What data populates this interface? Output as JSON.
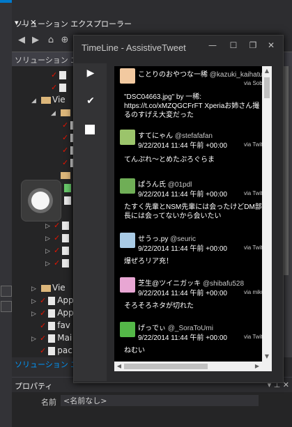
{
  "ide": {
    "solution_explorer_title": "ソリューション エクスプローラー",
    "solution_search_partial": "ソリューション エクス",
    "tree_items": [
      {
        "label": "",
        "checked": true,
        "kind": "image",
        "indent": 4
      },
      {
        "label": "",
        "checked": true,
        "kind": "image",
        "indent": 4
      },
      {
        "label": "Vie",
        "checked": true,
        "kind": "folder",
        "indent": 2,
        "expanded": true
      },
      {
        "label": "",
        "checked": false,
        "kind": "folder",
        "indent": 3
      },
      {
        "label": "",
        "checked": true,
        "kind": "file",
        "indent": 4
      },
      {
        "label": "",
        "checked": true,
        "kind": "file",
        "indent": 4
      },
      {
        "label": "",
        "checked": true,
        "kind": "file",
        "indent": 4
      },
      {
        "label": "",
        "checked": true,
        "kind": "file",
        "indent": 4
      },
      {
        "label": "",
        "checked": false,
        "kind": "folder",
        "indent": 3
      },
      {
        "label": "",
        "checked": false,
        "kind": "code",
        "indent": 4
      },
      {
        "label": "",
        "checked": false,
        "kind": "file",
        "indent": 4
      },
      {
        "label": "",
        "checked": true,
        "kind": "file",
        "indent": 4
      },
      {
        "label": "",
        "checked": true,
        "kind": "file",
        "indent": 4
      },
      {
        "label": "",
        "checked": true,
        "kind": "file",
        "indent": 4
      },
      {
        "label": "",
        "checked": true,
        "kind": "file",
        "indent": 4
      },
      {
        "label": "Vie",
        "checked": false,
        "kind": "folder",
        "indent": 2
      },
      {
        "label": "App",
        "checked": true,
        "kind": "file",
        "indent": 2
      },
      {
        "label": "App",
        "checked": true,
        "kind": "file",
        "indent": 2
      },
      {
        "label": "fav",
        "checked": true,
        "kind": "file",
        "indent": 2
      },
      {
        "label": "Mai",
        "checked": true,
        "kind": "file",
        "indent": 2
      },
      {
        "label": "pac",
        "checked": true,
        "kind": "file",
        "indent": 2
      }
    ],
    "solution_tab": "ソリューション エクスプ",
    "properties_title": "プロパティ",
    "properties_name_label": "名前",
    "properties_name_value": "<名前なし>"
  },
  "timeline": {
    "title": "TimeLine - AssistiveTweet",
    "sidebar_icons": [
      "play-icon",
      "check-icon",
      "stop-icon"
    ],
    "tweets": [
      {
        "name": "ことりのおやつな一稀",
        "screen_name": "@kazuki_kaihatu",
        "date": "",
        "via": "via",
        "source": "Soba",
        "text": "\"DSC04663.jpg\" by 一稀: https://t.co/xMZQGCFrFT Xperiaお姉さん撮るのすげえ大変だった",
        "avatar_color": "#f2c9a0"
      },
      {
        "name": "すてにゃん",
        "screen_name": "@stefafafan",
        "date": "9/22/2014 11:44 午前 +00:00",
        "via": "via",
        "source": "Twitt",
        "text": "てんぷれ～とめたぷろぐらま",
        "avatar_color": "#9bc46b"
      },
      {
        "name": "ぱうん氏",
        "screen_name": "@01pdl",
        "date": "9/22/2014 11:44 午前 +00:00",
        "via": "via",
        "source": "Twitt",
        "text": "たすく先輩とNSM先輩には会ったけどDM部長には会ってないから会いたい",
        "avatar_color": "#6fae56"
      },
      {
        "name": "せうっ.py",
        "screen_name": "@seuric",
        "date": "9/22/2014 11:44 午前 +00:00",
        "via": "via",
        "source": "Twitt",
        "text": "爆ぜろリア充！",
        "avatar_color": "#a9cbe6"
      },
      {
        "name": "芝生@ツイニガッキ",
        "screen_name": "@shibafu528",
        "date": "9/22/2014 11:44 午前 +00:00",
        "via": "via",
        "source": "miku",
        "text": "そろそろネタが切れた",
        "avatar_color": "#e8a6d3"
      },
      {
        "name": "げっでぃ",
        "screen_name": "@_SoraToUmi",
        "date": "9/22/2014 11:44 午前 +00:00",
        "via": "via",
        "source": "Twitt",
        "text": "ねむい",
        "avatar_color": "#54b848"
      }
    ]
  }
}
